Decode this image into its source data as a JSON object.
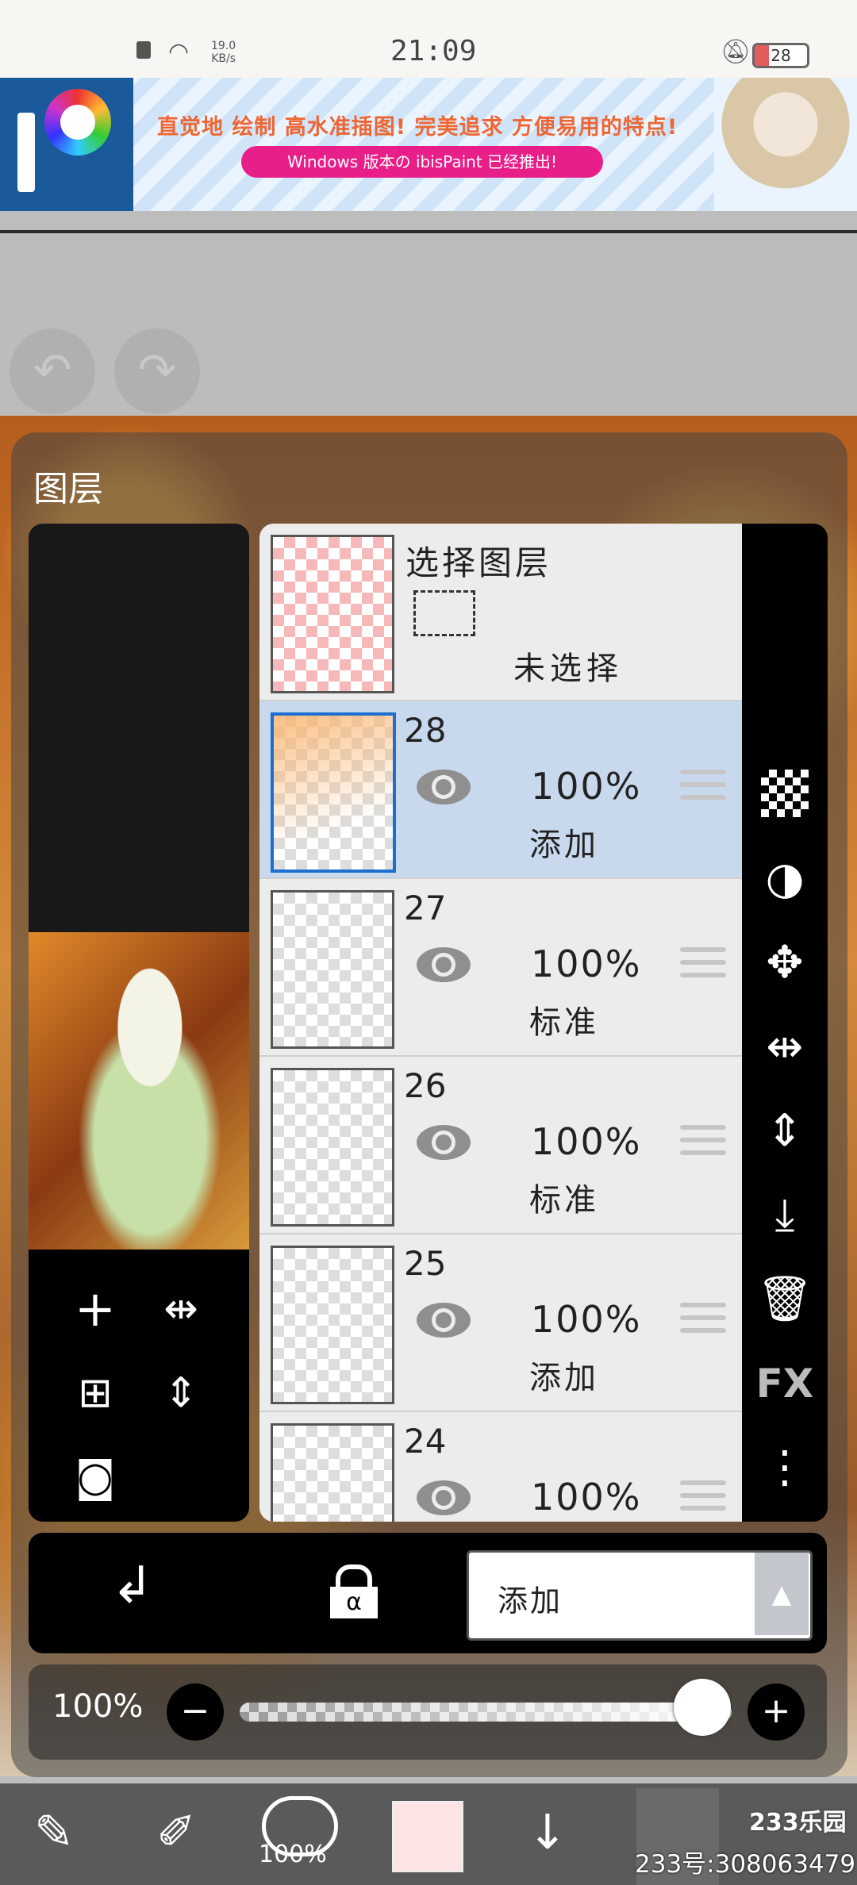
{
  "status_bar": {
    "time": "21:09",
    "speed_value": "19.0",
    "speed_unit": "KB/s",
    "battery": "28"
  },
  "ad": {
    "headline": "直觉地 绘制 高水准插图! 完美追求 方便易用的特点!",
    "subline": "Windows 版本の ibisPaint 已经推出!"
  },
  "panel": {
    "title": "图层"
  },
  "selection_layer": {
    "title": "选择图层",
    "status": "未选择"
  },
  "layers": [
    {
      "number": "28",
      "opacity": "100%",
      "blend": "添加",
      "selected": true
    },
    {
      "number": "27",
      "opacity": "100%",
      "blend": "标准",
      "selected": false
    },
    {
      "number": "26",
      "opacity": "100%",
      "blend": "标准",
      "selected": false
    },
    {
      "number": "25",
      "opacity": "100%",
      "blend": "添加",
      "selected": false
    },
    {
      "number": "24",
      "opacity": "100%",
      "blend": "",
      "selected": false
    }
  ],
  "right_toolbar": {
    "fx_label": "FX"
  },
  "blend_mode": {
    "current": "添加"
  },
  "layer_opacity": {
    "label": "100%",
    "value": 0.94
  },
  "bottom_toolbar": {
    "brush_size": "100%"
  },
  "watermark": {
    "logo": "233乐园",
    "text": "233号:308063479"
  },
  "colors": {
    "selected_row": "#c8d9ee",
    "selected_border": "#1c6fd0",
    "ad_pill": "#e81e89"
  }
}
